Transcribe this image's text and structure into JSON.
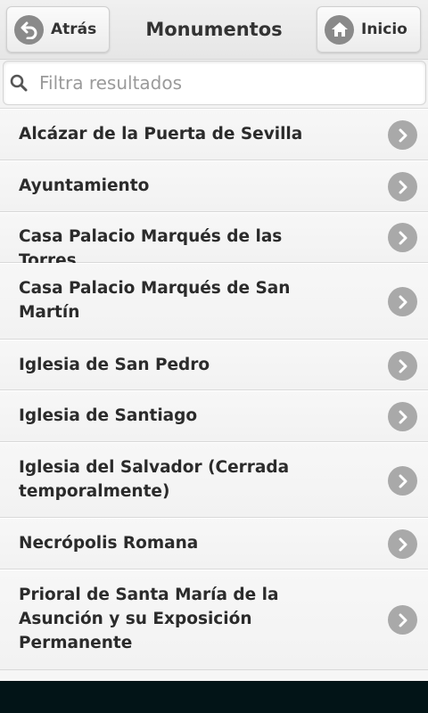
{
  "header": {
    "back_label": "Atrás",
    "title": "Monumentos",
    "home_label": "Inicio"
  },
  "search": {
    "placeholder": "Filtra resultados",
    "value": ""
  },
  "monuments": [
    "Alcázar de la Puerta de Sevilla",
    "Ayuntamiento",
    "Casa Palacio Marqués de las Torres",
    "Casa Palacio Marqués de San Martín",
    "Iglesia de San Pedro",
    "Iglesia de Santiago",
    "Iglesia del Salvador (Cerrada temporalmente)",
    "Necrópolis Romana",
    "Prioral de Santa María de la Asunción y su Exposición Permanente"
  ],
  "colors": {
    "chevron": "#a9a9a9",
    "icon_circle": "#8a8a8a",
    "system_bar": "#021417"
  },
  "icons": {
    "back": "back-arrow-icon",
    "home": "home-icon",
    "search": "search-icon",
    "item": "chevron-right-icon"
  }
}
